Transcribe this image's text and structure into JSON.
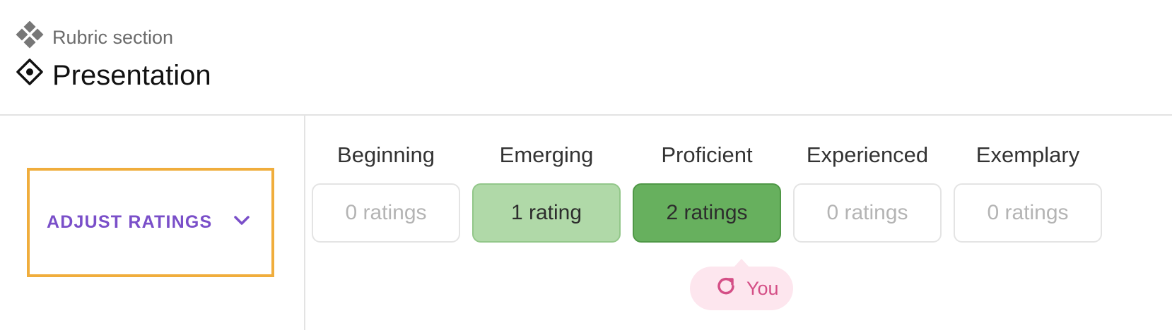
{
  "header": {
    "section_label": "Rubric section",
    "title": "Presentation",
    "section_icon": "rubric-section-icon",
    "title_icon": "criterion-diamond-icon"
  },
  "adjust": {
    "label": "ADJUST RATINGS",
    "icon": "chevron-down-icon",
    "accent_color": "#7a4fc9",
    "focus_color": "#f0ad3c"
  },
  "levels": [
    {
      "name": "Beginning",
      "count_text": "0 ratings",
      "style": "empty"
    },
    {
      "name": "Emerging",
      "count_text": "1 rating",
      "style": "light"
    },
    {
      "name": "Proficient",
      "count_text": "2 ratings",
      "style": "dark"
    },
    {
      "name": "Experienced",
      "count_text": "0 ratings",
      "style": "empty"
    },
    {
      "name": "Exemplary",
      "count_text": "0 ratings",
      "style": "empty"
    }
  ],
  "you_tag": {
    "label": "You",
    "icon": "refresh-icon",
    "level": "Proficient",
    "color": "#d44f86"
  }
}
